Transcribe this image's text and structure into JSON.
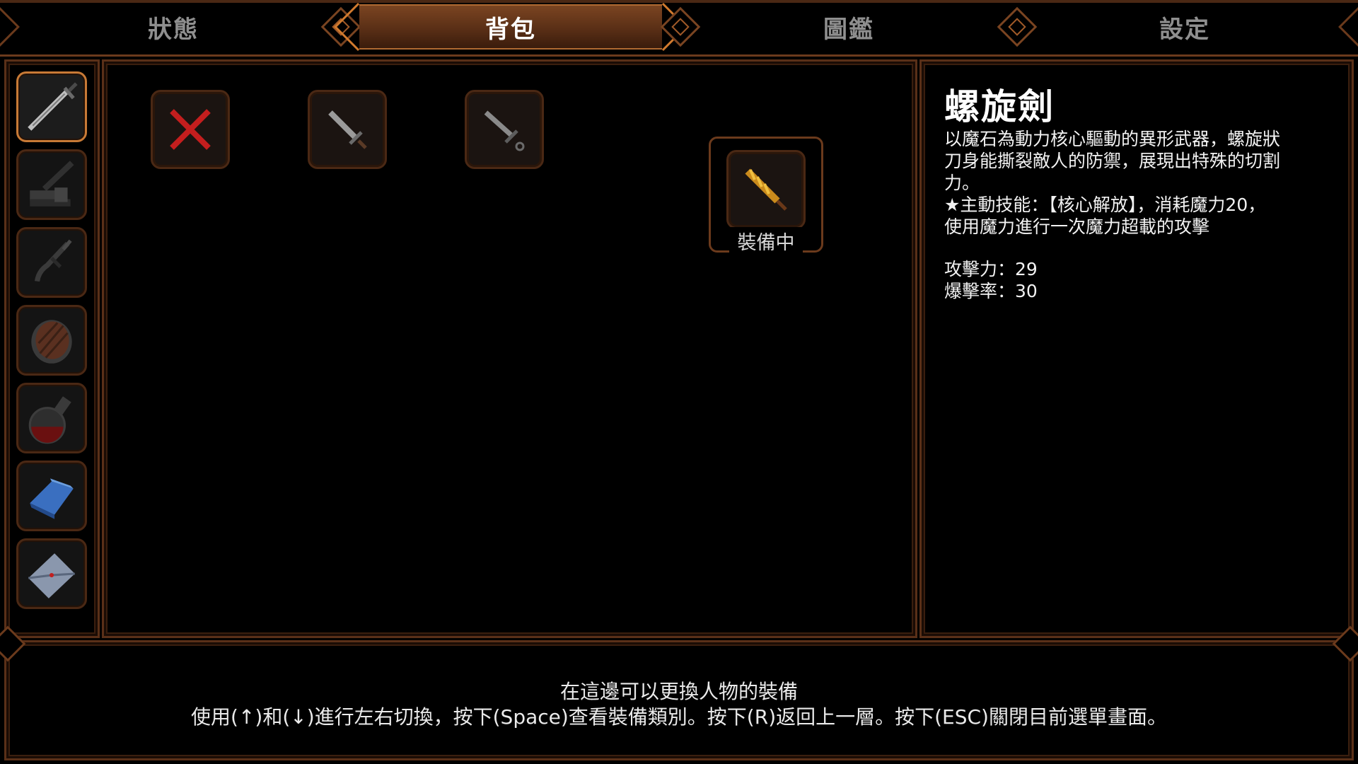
{
  "tabs": [
    {
      "label": "狀態",
      "active": false
    },
    {
      "label": "背包",
      "active": true
    },
    {
      "label": "圖鑑",
      "active": false
    },
    {
      "label": "設定",
      "active": false
    }
  ],
  "sidebar": {
    "categories": [
      {
        "icon": "sword-icon",
        "active": true
      },
      {
        "icon": "boot-icon",
        "active": false
      },
      {
        "icon": "dagger-icon",
        "active": false
      },
      {
        "icon": "shield-icon",
        "active": false
      },
      {
        "icon": "potion-icon",
        "active": false
      },
      {
        "icon": "crystal-icon",
        "active": false
      },
      {
        "icon": "letter-icon",
        "active": false
      }
    ]
  },
  "inventory": {
    "slots": [
      {
        "icon": "unequip-x-icon"
      },
      {
        "icon": "short-sword-icon"
      },
      {
        "icon": "rapier-icon"
      },
      {
        "icon": "spiral-sword-icon",
        "equipped": true
      }
    ],
    "equipped_label": "裝備中"
  },
  "detail": {
    "name": "螺旋劍",
    "description": "以魔石為動力核心驅動的異形武器，螺旋狀\n刀身能撕裂敵人的防禦，展現出特殊的切割\n力。\n★主動技能：【核心解放】，消耗魔力20，\n使用魔力進行一次魔力超載的攻擊",
    "stat1": "攻擊力：29",
    "stat2": "爆擊率：30"
  },
  "help": {
    "line1": "在這邊可以更換人物的裝備",
    "line2": "使用(↑)和(↓)進行左右切換，按下(Space)查看裝備類別。按下(R)返回上一層。按下(ESC)關閉目前選單畫面。"
  },
  "colors": {
    "frame": "#5a3018",
    "accent": "#c87a36",
    "active_tab": "#7a4421",
    "background": "#000000"
  }
}
